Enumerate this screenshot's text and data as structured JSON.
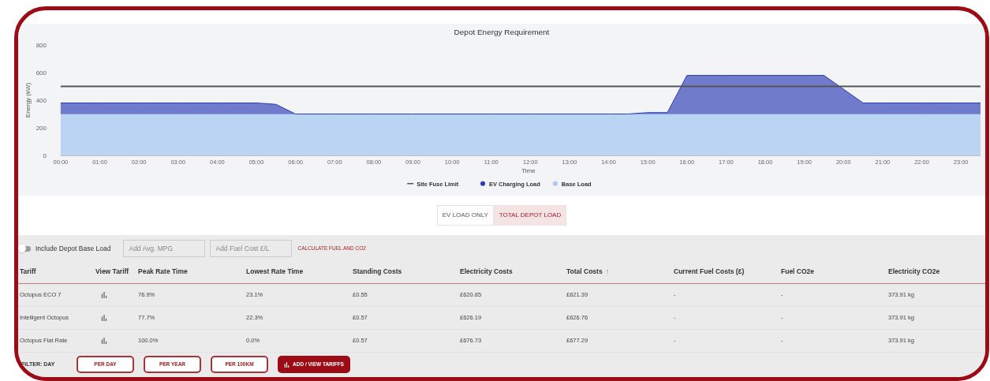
{
  "chart": {
    "chart_data": {
      "type": "area",
      "title": "Depot Energy Requirement",
      "xlabel": "Time",
      "ylabel": "Energy (kW)",
      "stacked": true,
      "x": [
        0,
        1,
        2,
        3,
        4,
        5,
        5.5,
        6,
        7,
        8,
        9,
        10,
        11,
        12,
        13,
        14,
        14.5,
        15,
        15.5,
        16,
        17,
        18,
        19,
        19.5,
        20,
        20.5,
        21,
        22,
        23,
        23.5
      ],
      "xticks": [
        {
          "value": 0,
          "label": "00:00"
        },
        {
          "value": 1,
          "label": "01:00"
        },
        {
          "value": 2,
          "label": "02:00"
        },
        {
          "value": 3,
          "label": "03:00"
        },
        {
          "value": 4,
          "label": "04:00"
        },
        {
          "value": 5,
          "label": "05:00"
        },
        {
          "value": 6,
          "label": "06:00"
        },
        {
          "value": 7,
          "label": "07:00"
        },
        {
          "value": 8,
          "label": "08:00"
        },
        {
          "value": 9,
          "label": "09:00"
        },
        {
          "value": 10,
          "label": "10:00"
        },
        {
          "value": 11,
          "label": "11:00"
        },
        {
          "value": 12,
          "label": "12:00"
        },
        {
          "value": 13,
          "label": "13:00"
        },
        {
          "value": 14,
          "label": "14:00"
        },
        {
          "value": 15,
          "label": "15:00"
        },
        {
          "value": 16,
          "label": "16:00"
        },
        {
          "value": 17,
          "label": "17:00"
        },
        {
          "value": 18,
          "label": "18:00"
        },
        {
          "value": 19,
          "label": "19:00"
        },
        {
          "value": 20,
          "label": "20:00"
        },
        {
          "value": 21,
          "label": "21:00"
        },
        {
          "value": 22,
          "label": "22:00"
        },
        {
          "value": 23,
          "label": "23:00"
        }
      ],
      "xlim": [
        0,
        23.5
      ],
      "ylim": [
        0,
        800
      ],
      "yticks": [
        0,
        200,
        400,
        600,
        800
      ],
      "legend": "bottom",
      "series": [
        {
          "name": "Site Fuse Limit",
          "type": "line",
          "color": "#555555",
          "values": [
            500,
            500,
            500,
            500,
            500,
            500,
            500,
            500,
            500,
            500,
            500,
            500,
            500,
            500,
            500,
            500,
            500,
            500,
            500,
            500,
            500,
            500,
            500,
            500,
            500,
            500,
            500,
            500,
            500,
            500
          ]
        },
        {
          "name": "EV Charging Load",
          "color": "#2b3bb5",
          "values": [
            80,
            80,
            80,
            80,
            80,
            80,
            70,
            0,
            0,
            0,
            0,
            0,
            0,
            0,
            0,
            0,
            0,
            10,
            10,
            280,
            280,
            280,
            280,
            280,
            180,
            80,
            80,
            80,
            80,
            80
          ]
        },
        {
          "name": "Base Load",
          "color": "#a9c9f2",
          "values": [
            300,
            300,
            300,
            300,
            300,
            300,
            300,
            300,
            300,
            300,
            300,
            300,
            300,
            300,
            300,
            300,
            300,
            300,
            300,
            300,
            300,
            300,
            300,
            300,
            300,
            300,
            300,
            300,
            300,
            300
          ]
        }
      ]
    }
  },
  "load_toggle": [
    {
      "label": "EV LOAD ONLY",
      "selected": false
    },
    {
      "label": "TOTAL DEPOT LOAD",
      "selected": true
    }
  ],
  "controls": {
    "base_load_switch": {
      "label": "Include Depot Base Load",
      "on": false
    },
    "mpg_field": {
      "placeholder": "Add Avg. MPG"
    },
    "fuel_cost_field": {
      "placeholder": "Add Fuel Cost £/L"
    },
    "calculate_link": "CALCULATE FUEL AND CO2"
  },
  "table": {
    "columns": [
      {
        "label": "Tariff"
      },
      {
        "label": "View Tariff"
      },
      {
        "label": "Peak Rate Time"
      },
      {
        "label": "Lowest Rate Time"
      },
      {
        "label": "Standing Costs"
      },
      {
        "label": "Electricity Costs"
      },
      {
        "label": "Total Costs",
        "sort_icon": "↑"
      },
      {
        "label": "Current Fuel Costs (£)"
      },
      {
        "label": "Fuel CO2e"
      },
      {
        "label": "Electricity CO2e"
      }
    ],
    "rows": [
      [
        "Octopus ECO 7",
        null,
        "76.9%",
        "23.1%",
        "£0.55",
        "£620.85",
        "£621.39",
        "-",
        "-",
        "373.91 kg"
      ],
      [
        "Intelligent Octopus",
        null,
        "77.7%",
        "22.3%",
        "£0.57",
        "£626.19",
        "£626.76",
        "-",
        "-",
        "373.91 kg"
      ],
      [
        "Octopus Flat Rate",
        null,
        "100.0%",
        "0.0%",
        "£0.57",
        "£676.73",
        "£677.29",
        "-",
        "-",
        "373.91 kg"
      ]
    ]
  },
  "filter": {
    "label": "FILTER: DAY",
    "buttons": [
      {
        "label": "PER DAY",
        "kind": "outline"
      },
      {
        "label": "PER YEAR",
        "kind": "outline"
      },
      {
        "label": "PER 100KM",
        "kind": "outline"
      },
      {
        "label": "ADD / VIEW TARIFFS",
        "kind": "filled"
      }
    ]
  }
}
